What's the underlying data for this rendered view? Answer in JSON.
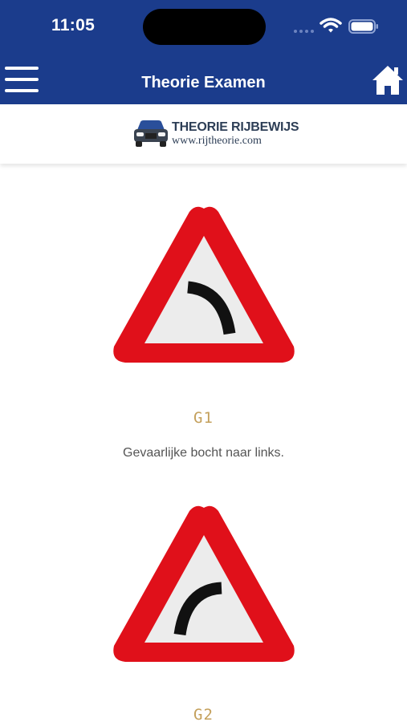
{
  "status_bar": {
    "time": "11:05",
    "icons": [
      "cellular-signal-icon",
      "wifi-icon",
      "battery-icon"
    ]
  },
  "nav": {
    "title": "Theorie Examen",
    "menu_icon": "hamburger-menu-icon",
    "home_icon": "home-icon"
  },
  "logo": {
    "title": "THEORIE RIJBEWIJS",
    "url": "www.rijtheorie.com"
  },
  "signs": [
    {
      "code": "G1",
      "description": "Gevaarlijke bocht naar links.",
      "icon": "warning-sign-curve-left-icon"
    },
    {
      "code": "G2",
      "description": "",
      "icon": "warning-sign-curve-right-icon"
    }
  ],
  "colors": {
    "nav_bar": "#1b3c8c",
    "sign_border": "#e0101a",
    "sign_fill": "#ececec",
    "code_text": "#c4a05c",
    "logo_text": "#2d3e56"
  }
}
